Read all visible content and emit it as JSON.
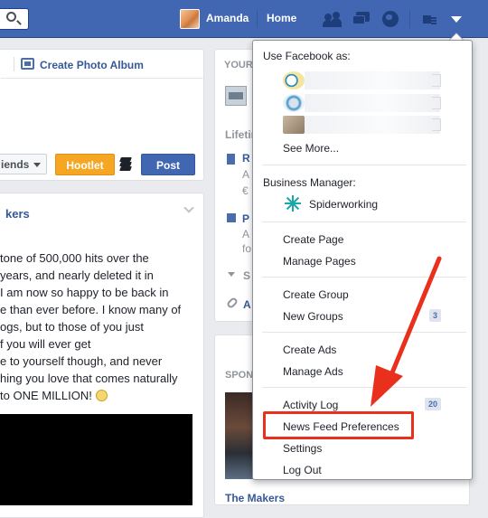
{
  "topbar": {
    "user_name": "Amanda",
    "home_label": "Home"
  },
  "composer": {
    "create_album_label": "Create Photo Album",
    "audience_label": "iends",
    "hootlet_label": "Hootlet",
    "post_label": "Post"
  },
  "post": {
    "author": "kers",
    "lines": [
      "tone of 500,000 hits over the",
      "years, and nearly deleted it in",
      "I am now so happy to be back in",
      "e than ever before. I know many of",
      "ogs, but to those of you just",
      "f you will ever get",
      "e to yourself though, and never",
      "hing you love that comes naturally",
      "to ONE MILLION!"
    ]
  },
  "sidebar": {
    "heading": "YOUR",
    "lifetime": "Lifetim",
    "r_item": "R",
    "a_item1": "A",
    "euro_item": "€",
    "p_item": "P",
    "a_item2": "A",
    "fo_item": "fo",
    "s_item": "S",
    "a_item3": "A",
    "sponsored_label": "SPON",
    "sponsored_title": "The Makers"
  },
  "menu": {
    "use_facebook_as": "Use Facebook as:",
    "see_more": "See More...",
    "business_manager": "Business Manager:",
    "business_name": "Spiderworking",
    "items": {
      "create_page": "Create Page",
      "manage_pages": "Manage Pages",
      "create_group": "Create Group",
      "new_groups": "New Groups",
      "new_groups_count": "3",
      "create_ads": "Create Ads",
      "manage_ads": "Manage Ads",
      "activity_log": "Activity Log",
      "activity_log_count": "20",
      "news_feed_preferences": "News Feed Preferences",
      "settings": "Settings",
      "log_out": "Log Out"
    }
  },
  "colors": {
    "brand_blue": "#4267b2",
    "annotation_red": "#e8301c",
    "hootlet_orange": "#f5a623"
  }
}
